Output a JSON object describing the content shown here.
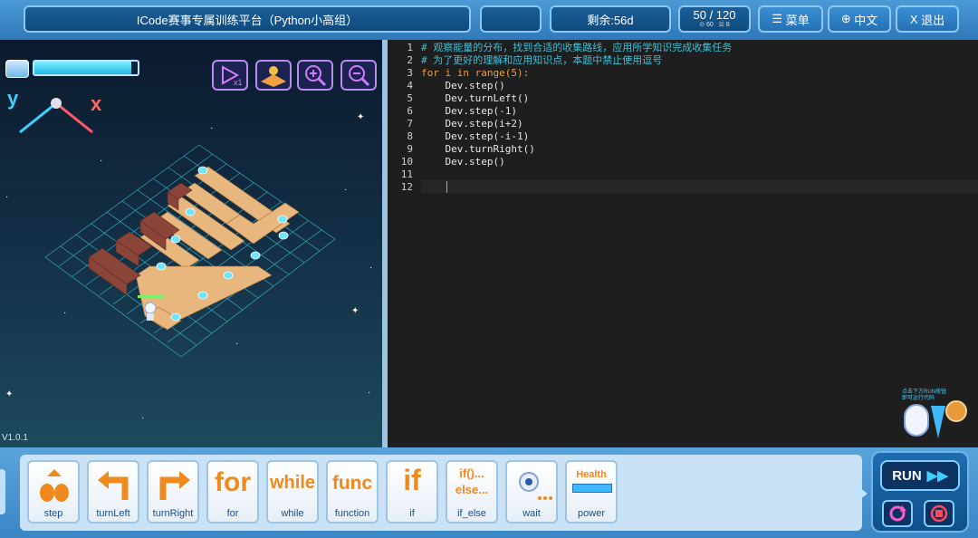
{
  "header": {
    "title": "ICode赛事专属训练平台（Python小高组）",
    "remaining": "剩余:56d",
    "score": "50 / 120",
    "score_sub_a": "60",
    "score_sub_b": "8",
    "menu_label": "菜单",
    "lang_label": "中文",
    "exit_label": "退出"
  },
  "game": {
    "version": "V1.0.1",
    "axis_y": "y",
    "axis_x": "x",
    "energy_percent": 94,
    "tools": [
      "speed-x1-icon",
      "map-icon",
      "zoom-in-icon",
      "zoom-out-icon"
    ]
  },
  "editor": {
    "line_numbers": [
      "1",
      "2",
      "3",
      "4",
      "5",
      "6",
      "7",
      "8",
      "9",
      "10",
      "11",
      "12"
    ],
    "lines": [
      "# 观察能量的分布，找到合适的收集路线，应用所学知识完成收集任务",
      "# 为了更好的理解和应用知识点，本题中禁止使用逗号",
      "for i in range(5):",
      "    Dev.step()",
      "    Dev.turnLeft()",
      "    Dev.step(-1)",
      "    Dev.step(i+2)",
      "    Dev.step(-i-1)",
      "    Dev.turnRight()",
      "    Dev.step()",
      "",
      ""
    ],
    "hint": "点击下方RUN按钮\n即可运行代码"
  },
  "blocks": [
    {
      "label": "step",
      "icon": "step-icon"
    },
    {
      "label": "turnLeft",
      "icon": "turn-left-icon"
    },
    {
      "label": "turnRight",
      "icon": "turn-right-icon"
    },
    {
      "label": "for",
      "icon_text": "for"
    },
    {
      "label": "while",
      "icon_text": "while"
    },
    {
      "label": "function",
      "icon_text": "func"
    },
    {
      "label": "if",
      "icon_text": "if"
    },
    {
      "label": "if_else",
      "icon_text": "if()...\nelse..."
    },
    {
      "label": "wait",
      "icon": "robot-icon"
    },
    {
      "label": "power",
      "icon_text": "Health"
    }
  ],
  "run": {
    "run_label": "RUN"
  }
}
